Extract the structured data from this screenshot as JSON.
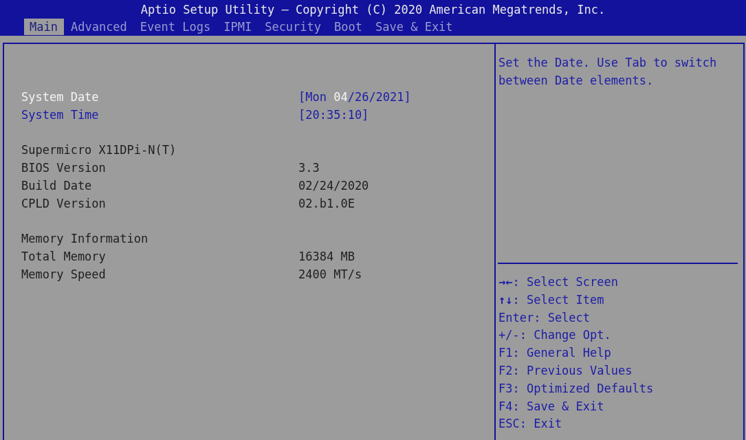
{
  "window": {
    "title": "Aptio Setup Utility – Copyright (C) 2020 American Megatrends, Inc."
  },
  "tabs": [
    {
      "label": "Main",
      "selected": true
    },
    {
      "label": "Advanced",
      "selected": false
    },
    {
      "label": "Event Logs",
      "selected": false
    },
    {
      "label": "IPMI",
      "selected": false
    },
    {
      "label": "Security",
      "selected": false
    },
    {
      "label": "Boot",
      "selected": false
    },
    {
      "label": "Save & Exit",
      "selected": false
    }
  ],
  "settings": [
    {
      "kind": "setting",
      "label": "System Date",
      "selected": true,
      "value_parts": [
        {
          "text": "[Mon ",
          "selected": false
        },
        {
          "text": "04",
          "selected": true
        },
        {
          "text": "/26/2021]",
          "selected": false
        }
      ]
    },
    {
      "kind": "setting",
      "label": "System Time",
      "selected": false,
      "value_parts": [
        {
          "text": "[20:35:10]",
          "selected": false
        }
      ]
    },
    {
      "kind": "spacer"
    },
    {
      "kind": "heading",
      "label": "Supermicro X11DPi-N(T)"
    },
    {
      "kind": "info",
      "label": "BIOS Version",
      "value": "3.3"
    },
    {
      "kind": "info",
      "label": "Build Date",
      "value": "02/24/2020"
    },
    {
      "kind": "info",
      "label": "CPLD Version",
      "value": "02.b1.0E"
    },
    {
      "kind": "spacer"
    },
    {
      "kind": "heading",
      "label": "Memory Information"
    },
    {
      "kind": "info",
      "label": "Total Memory",
      "value": "16384 MB"
    },
    {
      "kind": "info",
      "label": "Memory Speed",
      "value": "2400 MT/s"
    }
  ],
  "help_text": "Set the Date. Use Tab to switch between Date elements.",
  "key_help": [
    "**→←**: Select Screen",
    "**↑↓**: Select Item",
    "Enter: Select",
    "+/-: Change Opt.",
    "F1: General Help",
    "F2: Previous Values",
    "F3: Optimized Defaults",
    "F4: Save & Exit",
    "ESC: Exit"
  ]
}
